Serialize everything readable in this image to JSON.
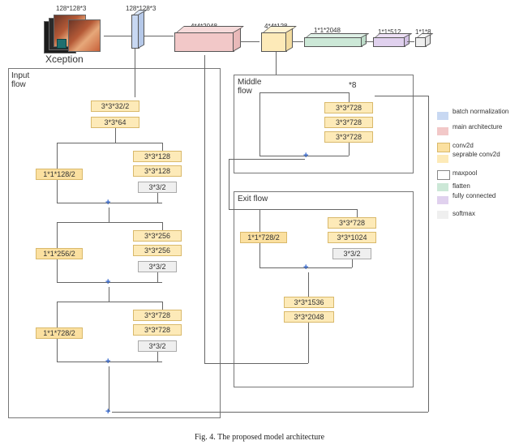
{
  "title_label": "Xception",
  "caption": "Fig. 4. The proposed model architecture",
  "dims": {
    "input_img": "128*128*3",
    "post_bn": "128*128*3",
    "main_arch": "4*4*2048",
    "after_sep": "4*4*128",
    "flatten": "1*1*2048",
    "fc": "1*1*512",
    "softmax": "1*1*8"
  },
  "legend": {
    "bn": "batch normalization",
    "main": "main architecture",
    "conv2d": "conv2d",
    "sep": "seprable conv2d",
    "maxpool": "maxpool",
    "flatten": "flatten",
    "fc": "fully connected",
    "softmax": "softmax"
  },
  "input_flow": {
    "title": "Input flow",
    "conv1": "3*3*32/2",
    "conv2": "3*3*64",
    "skip1": "1*1*128/2",
    "b1a": "3*3*128",
    "b1b": "3*3*128",
    "b1p": "3*3/2",
    "skip2": "1*1*256/2",
    "b2a": "3*3*256",
    "b2b": "3*3*256",
    "b2p": "3*3/2",
    "skip3": "1*1*728/2",
    "b3a": "3*3*728",
    "b3b": "3*3*728",
    "b3p": "3*3/2"
  },
  "middle_flow": {
    "title": "Middle flow",
    "repeat": "*8",
    "b1": "3*3*728",
    "b2": "3*3*728",
    "b3": "3*3*728"
  },
  "exit_flow": {
    "title": "Exit flow",
    "skip": "1*1*728/2",
    "b1": "3*3*728",
    "b2": "3*3*1024",
    "bp": "3*3/2",
    "c1": "3*3*1536",
    "c2": "3*3*2048"
  }
}
